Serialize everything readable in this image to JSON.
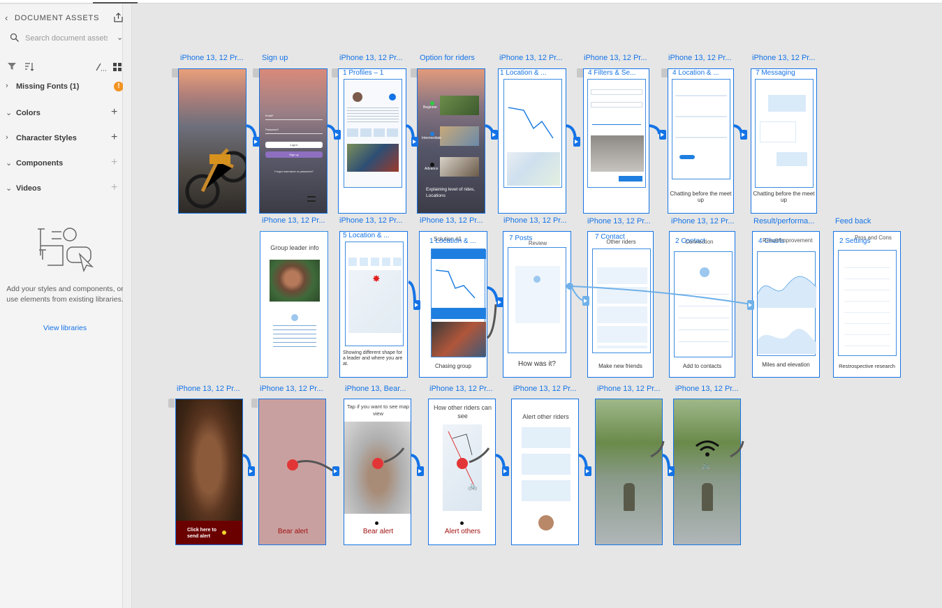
{
  "sidebar": {
    "title": "DOCUMENT ASSETS",
    "search_placeholder": "Search document assets",
    "sections": {
      "missing_fonts": "Missing Fonts (1)",
      "colors": "Colors",
      "character_styles": "Character Styles",
      "components": "Components",
      "videos": "Videos"
    },
    "warning_glyph": "!",
    "empty_message": "Add your styles and components, or use elements from existing libraries.",
    "view_libraries": "View libraries"
  },
  "row1": {
    "titles": [
      "iPhone 13, 12 Pr...",
      "Sign up",
      "iPhone 13, 12 Pr...",
      "Option for riders",
      "iPhone 13, 12 Pr...",
      "iPhone 13, 12 Pr...",
      "iPhone 13, 12 Pr...",
      "iPhone 13, 12 Pr..."
    ],
    "subtitles": [
      "1 Profiles – 1",
      "1 Location & ...",
      "4 Filters & Se...",
      "4 Location & ...",
      "7 Messaging"
    ],
    "signup": {
      "email": "Email*",
      "password": "Password*",
      "login": "Log in",
      "signup": "Sign up",
      "forgot": "Forgot username or password?"
    },
    "options": {
      "beginner": "Beginner",
      "intermediate": "Intermediate",
      "advance": "Advance",
      "caption": "Explaining level of rides, Locations"
    },
    "captions": {
      "chat1": "Chatting before the meet up",
      "chat2": "Chatting before the meet up"
    }
  },
  "row2": {
    "titles": [
      "iPhone 13, 12 Pr...",
      "iPhone 13, 12 Pr...",
      "iPhone 13, 12 Pr...",
      "iPhone 13, 12 Pr...",
      "iPhone 13, 12 Pr...",
      "iPhone 13, 12 Pr...",
      "Result/performa...",
      "Feed back"
    ],
    "overlays": [
      "5 Location & ...",
      "1 Location & ...",
      "7 Posts",
      "7 Contact",
      "2 Contact",
      "4 Charts",
      "2 Settings"
    ],
    "headers": [
      "Group leader info",
      "Solution #1",
      "Review",
      "Other riders",
      "Connection",
      "Result/Improvement",
      "Pros and Cons"
    ],
    "captions": [
      "Showing different shape for a leader and where you are at.",
      "Chasing group",
      "How was it?",
      "Make new friends",
      "Add to contacts",
      "Miles and elevation",
      "Restrospective research"
    ]
  },
  "row3": {
    "titles": [
      "iPhone 13, 12 Pr...",
      "iPhone 13, 12 Pr...",
      "iPhone 13, Bear...",
      "iPhone 13, 12 Pr...",
      "iPhone 13, 12 Pr...",
      "iPhone 13, 12 Pr...",
      "iPhone 13, 12 Pr..."
    ],
    "click_to_send": "Click here to send alert",
    "bear_alert": "Bear alert",
    "bear_alert2": "Bear alert",
    "tap_map": "Tap if you want to see map view",
    "how_other": "How other riders can see",
    "alert_others": "Alert others",
    "alert_other_riders": "Alert other riders"
  },
  "colors": {
    "accent": "#1473e6",
    "warning": "#f29423",
    "bear_red": "#8b0000"
  },
  "icons": [
    "chevron-left-icon",
    "export-icon",
    "search-icon",
    "chevron-down-icon",
    "filter-icon",
    "sort-icon",
    "path-icon",
    "grid-icon",
    "chevron-right-icon",
    "plus-icon",
    "warning-icon",
    "wifi-icon",
    "bicycle-icon"
  ]
}
